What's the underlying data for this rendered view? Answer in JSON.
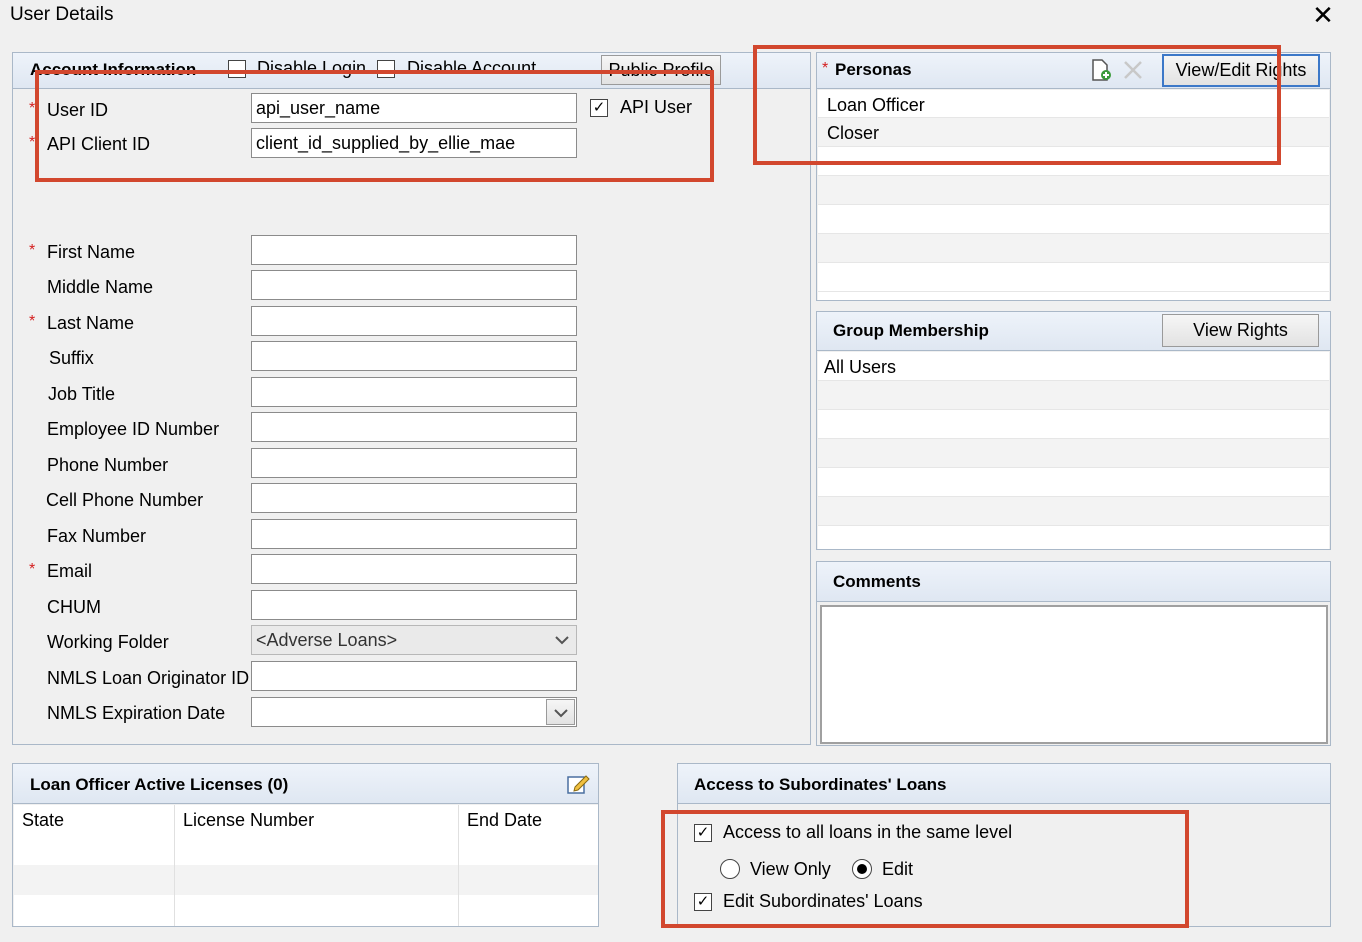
{
  "window": {
    "title": "User Details",
    "close_symbol": "✕"
  },
  "account": {
    "header": "Account Information",
    "disable_login": "Disable Login",
    "disable_account": "Disable Account",
    "public_profile": "Public Profile",
    "api_user": "API User",
    "check_mark": "✓",
    "required_mark": "*",
    "user_id_label": "User ID",
    "user_id_value": "api_user_name",
    "api_client_id_label": "API Client ID",
    "api_client_id_value": "client_id_supplied_by_ellie_mae",
    "fields": {
      "first_name": "First Name",
      "middle_name": "Middle Name",
      "last_name": "Last Name",
      "suffix": "Suffix",
      "job_title": "Job Title",
      "employee_id": "Employee ID Number",
      "phone": "Phone Number",
      "cell_phone": "Cell Phone Number",
      "fax": "Fax Number",
      "email": "Email",
      "chum": "CHUM",
      "working_folder": "Working Folder",
      "nmls_id": "NMLS Loan Originator ID",
      "nmls_exp": "NMLS Expiration Date"
    },
    "working_folder_value": "<Adverse Loans>"
  },
  "personas": {
    "header": "Personas",
    "view_edit_rights": "View/Edit Rights",
    "items": [
      "Loan Officer",
      "Closer"
    ]
  },
  "groups": {
    "header": "Group Membership",
    "view_rights": "View Rights",
    "items": [
      "All Users"
    ]
  },
  "comments": {
    "header": "Comments"
  },
  "licenses": {
    "header": "Loan Officer Active Licenses (0)",
    "columns": [
      "State",
      "License Number",
      "End Date"
    ]
  },
  "subordinates": {
    "header": "Access to Subordinates' Loans",
    "access_all": "Access to all loans in the same level",
    "view_only": "View Only",
    "edit": "Edit",
    "edit_subordinates": "Edit Subordinates' Loans"
  },
  "icons": {
    "add": "add-persona-icon",
    "delete": "delete-persona-icon",
    "edit": "edit-licenses-icon",
    "dropdown": "chevron-down-icon"
  },
  "colors": {
    "highlight": "#d2472e",
    "required": "#d42020",
    "panel_border": "#aab8c8"
  }
}
